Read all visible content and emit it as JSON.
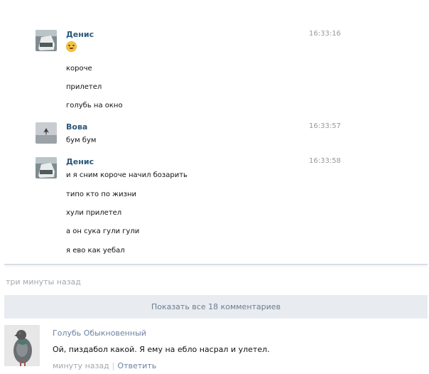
{
  "chat": {
    "groups": [
      {
        "sender": "Денис",
        "time": "16:33:16",
        "emoji": "😆",
        "lines": [
          "короче",
          "прилетел",
          "голубь на окно"
        ]
      },
      {
        "sender": "Вова",
        "time": "16:33:57",
        "lines": [
          "бум бум"
        ]
      },
      {
        "sender": "Денис",
        "time": "16:33:58",
        "lines": [
          "и я сним короче начил бозарить",
          "типо кто по жизни",
          "хули прилетел",
          "а он сука гули гули",
          "я ево как уебал"
        ]
      }
    ]
  },
  "post": {
    "timeago": "три минуты назад",
    "show_all_label": "Показать все 18 комментариев"
  },
  "comment": {
    "author": "Голубь Обыкновенный",
    "text": "Ой, пиздабол какой. Я ему на ебло насрал и улетел.",
    "time": "минуту назад",
    "reply_label": "Ответить"
  }
}
